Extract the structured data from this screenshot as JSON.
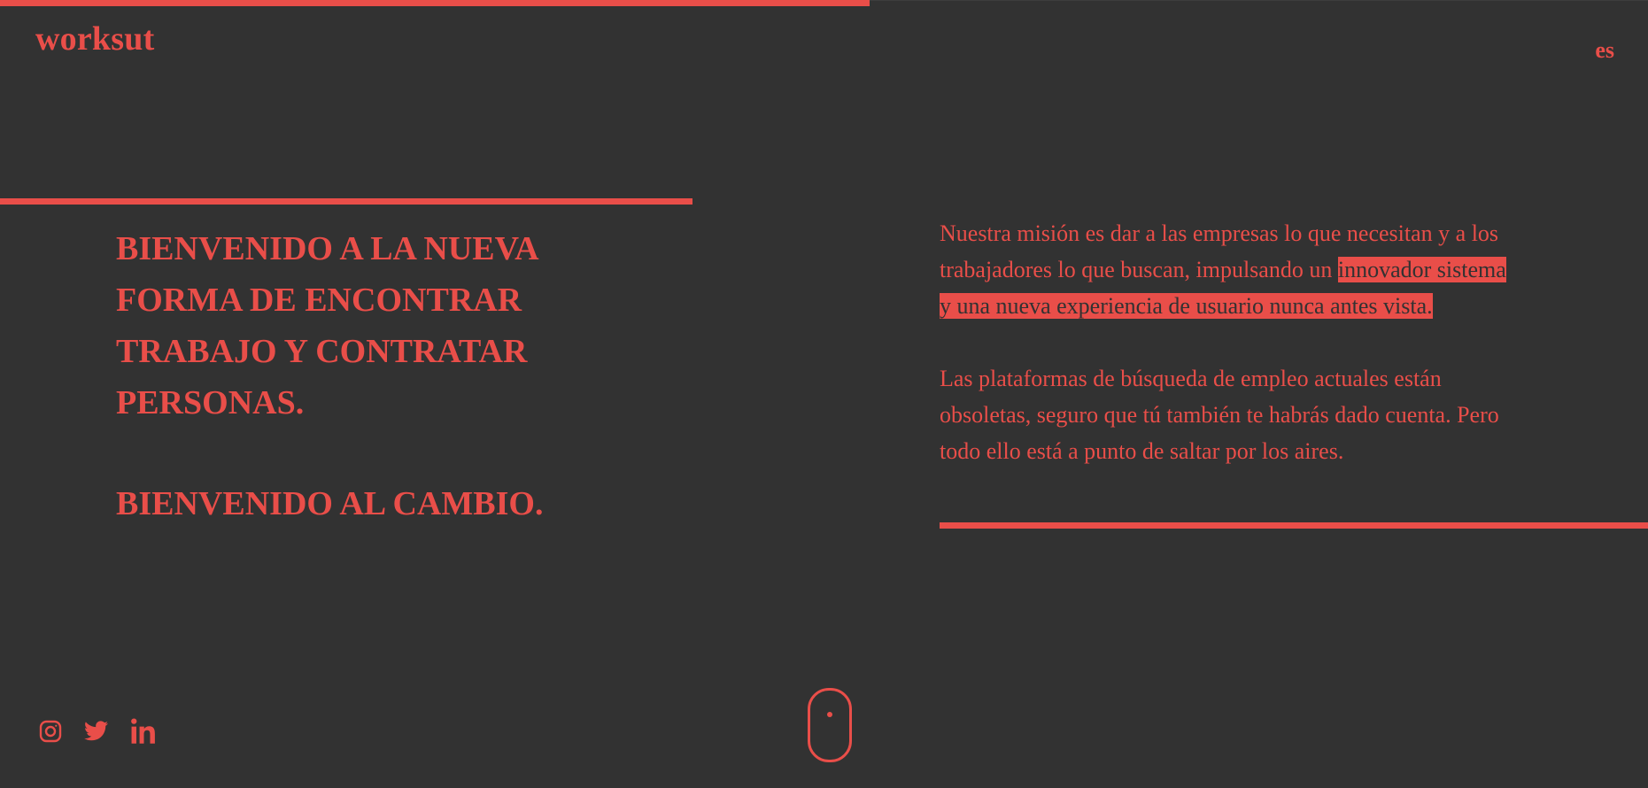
{
  "header": {
    "logo": "worksut",
    "language": "es",
    "scroll_progress": 0.5275
  },
  "hero": {
    "headline": "Bienvenido a la nueva forma de encontrar trabajo y contratar personas.",
    "tagline": "Bienvenido al cambio."
  },
  "mission": {
    "para1_before": "Nuestra misión es dar a las empresas lo que necesitan y a los trabajadores lo que buscan, impulsando un ",
    "para1_highlight": "innovador sistema y una nueva experiencia de usuario nunca antes vista.",
    "para2": "Las plataformas de búsqueda de empleo actuales están obsoletas, seguro que tú también te habrás dado cuenta. Pero todo ello está a punto de saltar por los aires."
  },
  "socials": [
    {
      "icon": "instagram-icon"
    },
    {
      "icon": "twitter-icon"
    },
    {
      "icon": "linkedin-icon"
    }
  ],
  "scroll_indicator": {
    "icon": "mouse-scroll-icon"
  },
  "colors": {
    "background": "#323232",
    "accent": "#e94e49"
  }
}
